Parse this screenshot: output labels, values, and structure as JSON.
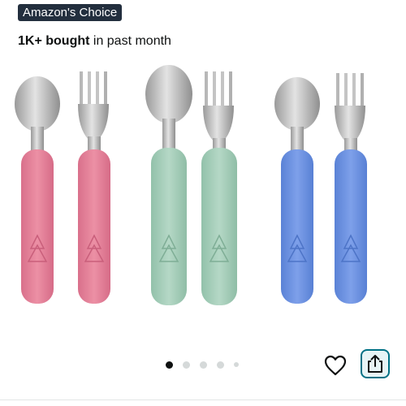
{
  "badge": {
    "label": "Amazon's Choice"
  },
  "social_proof": {
    "count": "1K+ bought",
    "suffix": " in past month"
  },
  "carousel": {
    "total": 5,
    "active_index": 0
  },
  "icons": {
    "favorite": "heart-icon",
    "share": "share-icon"
  },
  "colors": {
    "badge_bg": "#232f3e",
    "pink_handle": "#e8889e",
    "sage_handle": "#a9d2bd",
    "blue_handle": "#6f95e3",
    "share_border": "#007185"
  }
}
